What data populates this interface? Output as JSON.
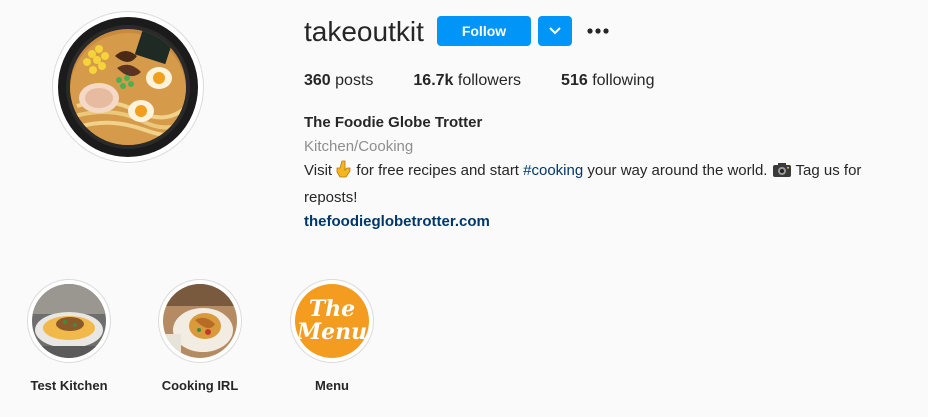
{
  "profile": {
    "username": "takeoutkit",
    "follow_label": "Follow",
    "dropdown_icon": "chevron-down-icon",
    "more_icon": "more-options-icon",
    "avatar": "ramen-bowl-avatar"
  },
  "stats": {
    "posts_count": "360",
    "posts_label": "posts",
    "followers_count": "16.7k",
    "followers_label": "followers",
    "following_count": "516",
    "following_label": "following"
  },
  "bio": {
    "name": "The Foodie Globe Trotter",
    "category": "Kitchen/Cooking",
    "text_1": "Visit ",
    "text_2": " for free recipes and start ",
    "hashtag": "#cooking",
    "text_3": " your way around the world. ",
    "text_4": " Tag us for reposts!",
    "link": "thefoodieglobetrotter.com"
  },
  "highlights": [
    {
      "label": "Test Kitchen"
    },
    {
      "label": "Cooking IRL"
    },
    {
      "label": "Menu",
      "image_text_1": "The",
      "image_text_2": "Menu"
    }
  ],
  "colors": {
    "accent": "#0095f6",
    "link": "#00376b",
    "muted": "#8e8e8e",
    "background": "#fafafa",
    "menu_orange": "#f39c1f"
  }
}
